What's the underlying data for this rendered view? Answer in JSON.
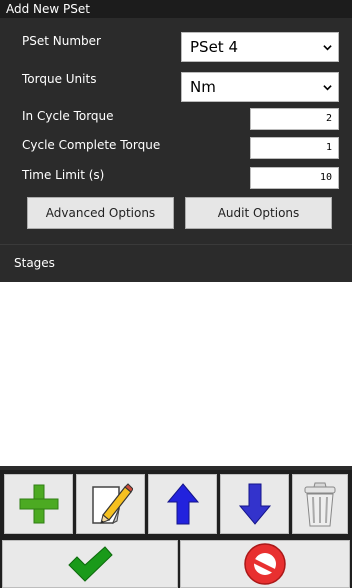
{
  "window": {
    "title": "Add New PSet"
  },
  "form": {
    "pset_number": {
      "label": "PSet Number",
      "value": "PSet 4"
    },
    "torque_units": {
      "label": "Torque Units",
      "value": "Nm"
    },
    "in_cycle_torque": {
      "label": "In Cycle Torque",
      "value": "2"
    },
    "cycle_complete_torque": {
      "label": "Cycle Complete Torque",
      "value": "1"
    },
    "time_limit": {
      "label": "Time Limit (s)",
      "value": "10"
    }
  },
  "buttons": {
    "advanced": "Advanced Options",
    "audit": "Audit Options"
  },
  "stages": {
    "title": "Stages"
  },
  "toolbar_icons": [
    "add-icon",
    "edit-icon",
    "move-up-icon",
    "move-down-icon",
    "delete-icon"
  ],
  "action_icons": [
    "confirm-icon",
    "cancel-icon"
  ],
  "colors": {
    "add": "#4caa22",
    "arrow_up": "#2222dd",
    "arrow_down": "#3333cc",
    "confirm": "#1a9a1a",
    "cancel": "#e83030"
  }
}
